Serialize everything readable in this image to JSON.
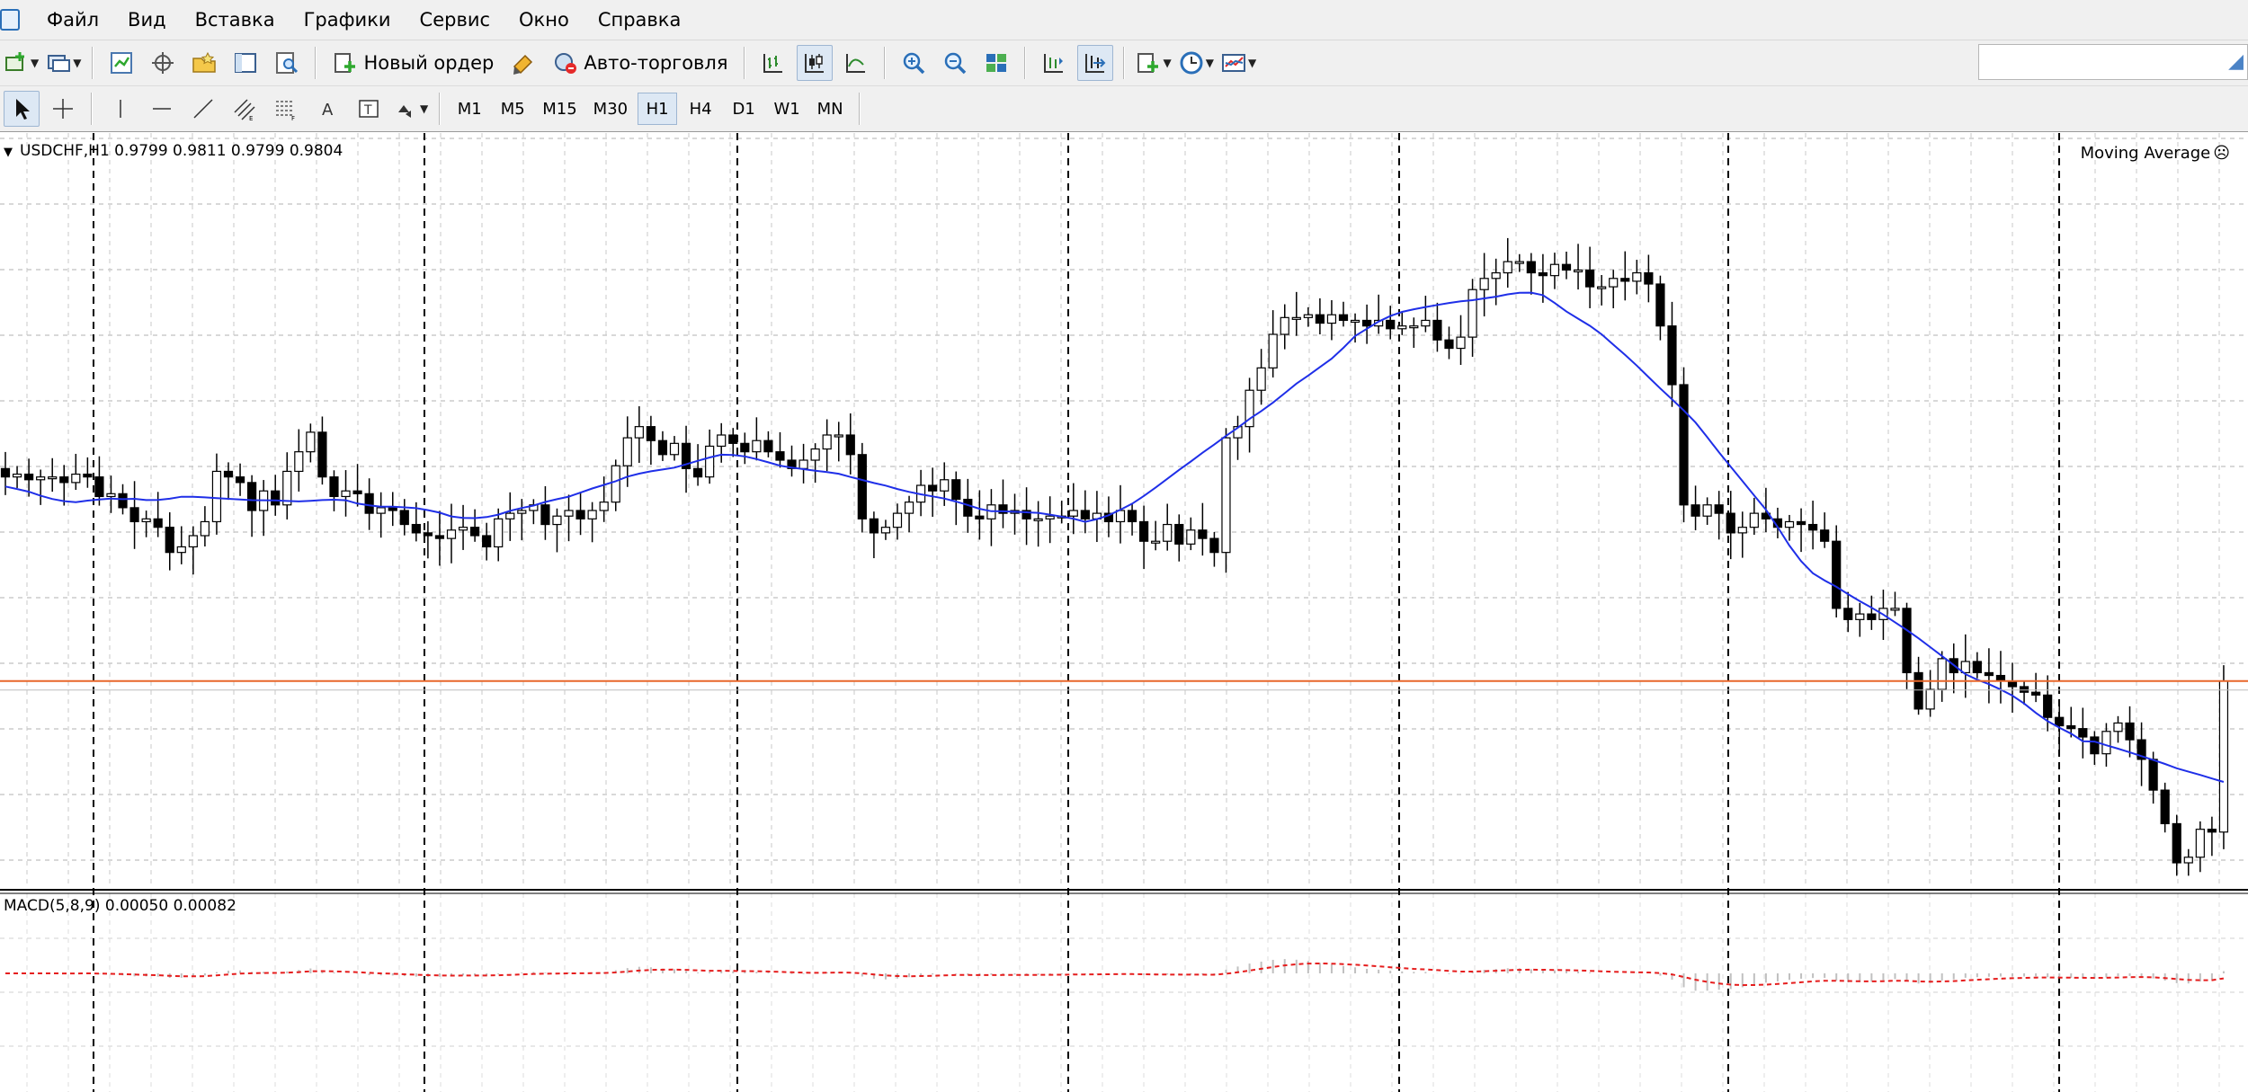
{
  "menu": {
    "items": [
      "Файл",
      "Вид",
      "Вставка",
      "Графики",
      "Сервис",
      "Окно",
      "Справка"
    ]
  },
  "toolbar": {
    "new_order_label": "Новый ордер",
    "autotrade_label": "Авто-торговля",
    "timeframes": [
      "M1",
      "M5",
      "M15",
      "M30",
      "H1",
      "H4",
      "D1",
      "W1",
      "MN"
    ],
    "active_timeframe": "H1"
  },
  "search": {
    "value": "",
    "placeholder": ""
  },
  "chart": {
    "symbol_title": "USDCHF,H1  0.9799 0.9811 0.9799 0.9804",
    "indicator_label": "Moving Average",
    "macd_label": "MACD(5,8,9) 0.00050 0.00082",
    "colors": {
      "candle": "#000000",
      "moving_average": "#1f2fe8",
      "price_line": "#e8672a",
      "macd_signal": "#e51d1d",
      "macd_histogram": "#c0c0c0",
      "grid": "#b0b0b0"
    }
  },
  "chart_data": {
    "type": "candlestick",
    "symbol": "USDCHF",
    "timeframe": "H1",
    "last_bar": {
      "open": 0.9799,
      "high": 0.9811,
      "low": 0.9799,
      "close": 0.9804
    },
    "price_line": 0.9804,
    "closes": [
      0.9877,
      0.9878,
      0.9876,
      0.9877,
      0.9877,
      0.9875,
      0.9878,
      0.9877,
      0.987,
      0.9871,
      0.9866,
      0.9861,
      0.9862,
      0.9859,
      0.985,
      0.9852,
      0.9856,
      0.9861,
      0.9879,
      0.9877,
      0.9875,
      0.9865,
      0.9872,
      0.9867,
      0.9879,
      0.9886,
      0.9893,
      0.9877,
      0.987,
      0.9872,
      0.9871,
      0.9864,
      0.9866,
      0.9865,
      0.986,
      0.9857,
      0.9856,
      0.9855,
      0.9858,
      0.9859,
      0.9856,
      0.9852,
      0.9862,
      0.9864,
      0.9865,
      0.9867,
      0.986,
      0.9863,
      0.9865,
      0.9862,
      0.9865,
      0.9868,
      0.9881,
      0.9891,
      0.9895,
      0.989,
      0.9885,
      0.9889,
      0.988,
      0.9877,
      0.9888,
      0.9892,
      0.9889,
      0.9886,
      0.989,
      0.9886,
      0.9883,
      0.988,
      0.9883,
      0.9887,
      0.9892,
      0.9892,
      0.9885,
      0.9862,
      0.9857,
      0.9859,
      0.9864,
      0.9868,
      0.9874,
      0.9872,
      0.9876,
      0.9869,
      0.9863,
      0.9862,
      0.9867,
      0.9864,
      0.9865,
      0.9862,
      0.9862,
      0.9863,
      0.9863,
      0.9865,
      0.9862,
      0.9864,
      0.9861,
      0.9865,
      0.9861,
      0.9854,
      0.9854,
      0.986,
      0.9853,
      0.9858,
      0.9855,
      0.985,
      0.9891,
      0.9895,
      0.9908,
      0.9916,
      0.9928,
      0.9934,
      0.9934,
      0.9935,
      0.9932,
      0.9935,
      0.9933,
      0.9933,
      0.9931,
      0.9933,
      0.993,
      0.9931,
      0.9931,
      0.9933,
      0.9926,
      0.9923,
      0.9927,
      0.9944,
      0.9948,
      0.995,
      0.9954,
      0.9954,
      0.995,
      0.9949,
      0.9953,
      0.9951,
      0.9951,
      0.9945,
      0.9945,
      0.9948,
      0.9947,
      0.995,
      0.9946,
      0.9931,
      0.991,
      0.9867,
      0.9863,
      0.9867,
      0.9864,
      0.9857,
      0.9859,
      0.9864,
      0.9862,
      0.9859,
      0.9861,
      0.986,
      0.9858,
      0.9854,
      0.983,
      0.9826,
      0.9828,
      0.9826,
      0.983,
      0.983,
      0.9807,
      0.9794,
      0.9801,
      0.9812,
      0.9807,
      0.9811,
      0.9807,
      0.9806,
      0.9804,
      0.9802,
      0.98,
      0.9799,
      0.9791,
      0.9788,
      0.9787,
      0.9784,
      0.9778,
      0.9786,
      0.9789,
      0.9783,
      0.9776,
      0.9765,
      0.9753,
      0.9739,
      0.9741,
      0.9751,
      0.975,
      0.9804
    ],
    "moving_average_shape": "smooth line rising from left, peaking near right-center, falling at far right",
    "macd": {
      "fast": 5,
      "slow": 8,
      "signal": 9,
      "main": 0.0005,
      "signal_value": 0.00082
    },
    "grid": true,
    "legend": "top-right"
  }
}
